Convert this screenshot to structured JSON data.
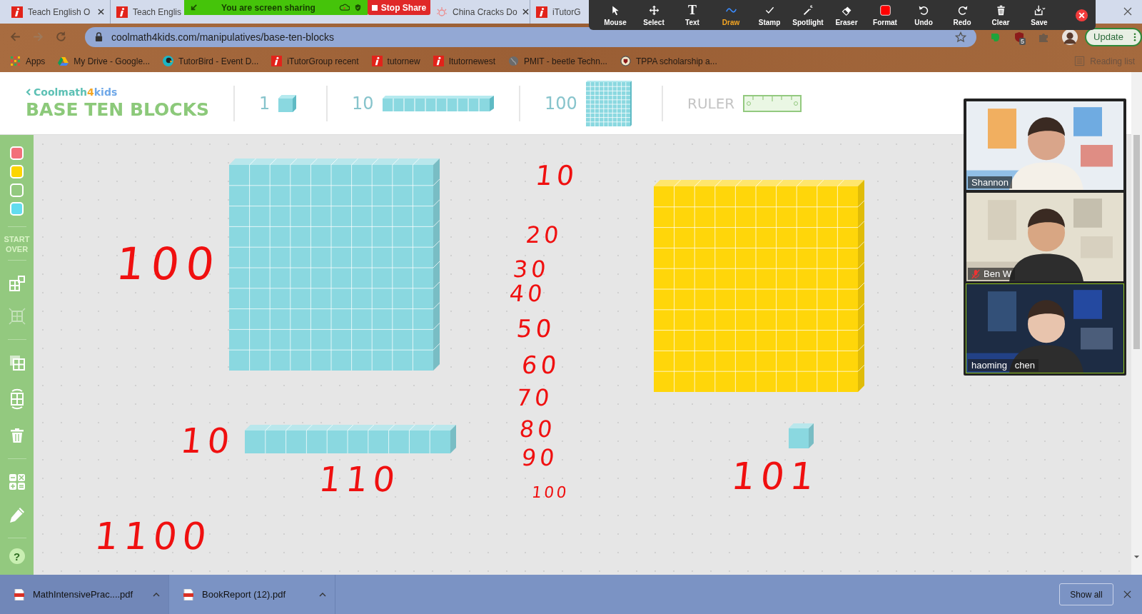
{
  "browser_tabs": [
    {
      "title": "Teach English O",
      "kind": "itutor"
    },
    {
      "title": "Teach Englis",
      "kind": "itutor"
    },
    {
      "title": "China Cracks Do",
      "kind": "sun"
    },
    {
      "title": "iTutorG",
      "kind": "itutor"
    }
  ],
  "sharing_bar": {
    "text": "You are screen sharing",
    "stop_label": "Stop Share"
  },
  "annotation_toolbar": {
    "tools": [
      {
        "label": "Mouse",
        "kind": "mouse",
        "selected": false
      },
      {
        "label": "Select",
        "kind": "select",
        "selected": false
      },
      {
        "label": "Text",
        "kind": "text",
        "glyph": "T",
        "selected": false
      },
      {
        "label": "Draw",
        "kind": "draw",
        "selected": true
      },
      {
        "label": "Stamp",
        "kind": "stamp",
        "selected": false
      },
      {
        "label": "Spotlight",
        "kind": "spotlight",
        "selected": false
      },
      {
        "label": "Eraser",
        "kind": "eraser",
        "selected": false
      },
      {
        "label": "Format",
        "kind": "format",
        "selected": false
      },
      {
        "label": "Undo",
        "kind": "undo",
        "selected": false
      },
      {
        "label": "Redo",
        "kind": "redo",
        "selected": false
      },
      {
        "label": "Clear",
        "kind": "clear",
        "selected": false
      },
      {
        "label": "Save",
        "kind": "save",
        "selected": false
      }
    ]
  },
  "address_bar": {
    "url": "coolmath4kids.com/manipulatives/base-ten-blocks",
    "extension_badge": "5",
    "update_label": "Update"
  },
  "bookmarks": [
    {
      "label": "Apps",
      "kind": "apps"
    },
    {
      "label": "My Drive - Google...",
      "kind": "drive"
    },
    {
      "label": "TutorBird - Event D...",
      "kind": "bird"
    },
    {
      "label": "iTutorGroup recent",
      "kind": "itutor"
    },
    {
      "label": "tutornew",
      "kind": "itutor"
    },
    {
      "label": "Itutornewest",
      "kind": "itutor"
    },
    {
      "label": "PMIT - beetle Techn...",
      "kind": "globe"
    },
    {
      "label": "TPPA scholarship a...",
      "kind": "seal"
    }
  ],
  "reading_list": "Reading list",
  "header": {
    "brand": [
      {
        "text": "Coolmath",
        "color": "#5cc0b4"
      },
      {
        "text": "4",
        "color": "#f5a623"
      },
      {
        "text": "kids",
        "color": "#6fa8e8"
      }
    ],
    "title": "BASE TEN BLOCKS",
    "palette": [
      {
        "label": "1",
        "kind": "cube"
      },
      {
        "label": "10",
        "kind": "rod"
      },
      {
        "label": "100",
        "kind": "flat"
      },
      {
        "label": "RULER",
        "kind": "ruler"
      }
    ]
  },
  "sidebar": {
    "swatches": [
      {
        "color": "#f2707a"
      },
      {
        "color": "#fcd500"
      },
      {
        "color": "#93c97f"
      },
      {
        "color": "#62dcef"
      }
    ],
    "start_over": "START OVER",
    "help_label": "?"
  },
  "canvas": {
    "blocks": [
      {
        "kind": "flat",
        "color": "#8ad8e0"
      },
      {
        "kind": "flat",
        "color": "#ffd60a"
      },
      {
        "kind": "rod",
        "color": "#8ad8e0"
      },
      {
        "kind": "cube",
        "color": "#8ad8e0"
      }
    ],
    "annotations": [
      {
        "text": "100"
      },
      {
        "text": "10"
      },
      {
        "text": "20"
      },
      {
        "text": "30"
      },
      {
        "text": "40"
      },
      {
        "text": "50"
      },
      {
        "text": "60"
      },
      {
        "text": "70"
      },
      {
        "text": "80"
      },
      {
        "text": "90"
      },
      {
        "text": "100"
      },
      {
        "text": "10"
      },
      {
        "text": "110"
      },
      {
        "text": "101"
      },
      {
        "text": "1100"
      }
    ]
  },
  "participants": [
    {
      "name": "Shannon",
      "muted": false,
      "active": false
    },
    {
      "name": "Ben W",
      "muted": true,
      "active": false
    },
    {
      "name": "haoming   chen",
      "muted": false,
      "active": true
    }
  ],
  "downloads": {
    "files": [
      {
        "name": "MathIntensivePrac....pdf"
      },
      {
        "name": "BookReport (12).pdf"
      }
    ],
    "show_all": "Show all"
  }
}
